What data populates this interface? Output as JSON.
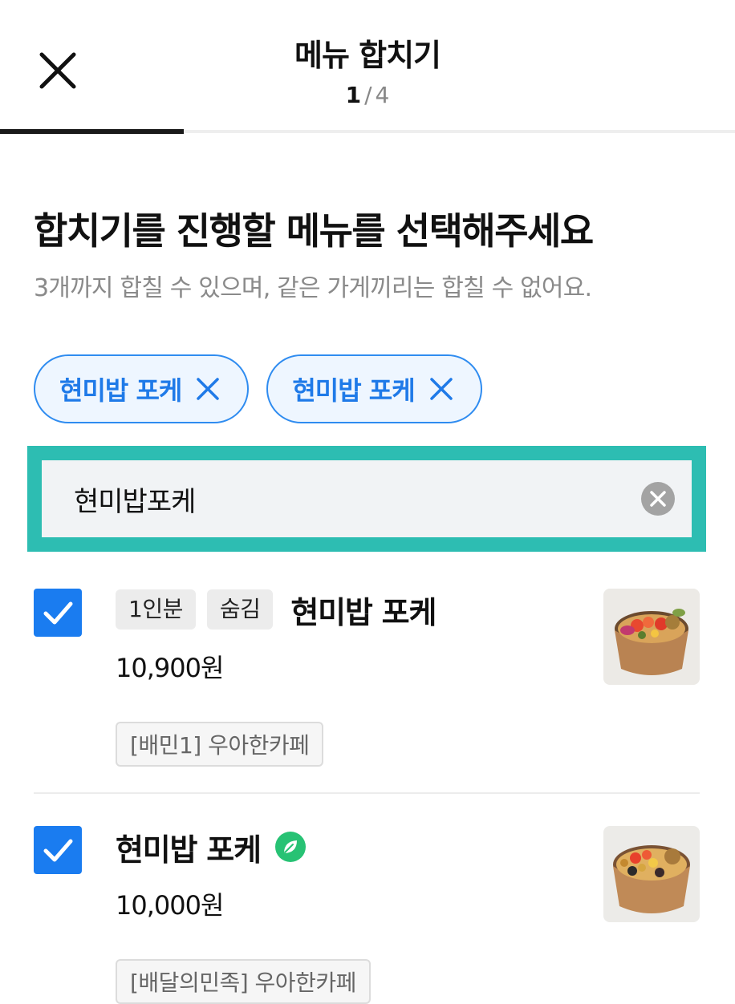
{
  "header": {
    "title": "메뉴 합치기",
    "step_current": "1",
    "step_separator": "/",
    "step_total": "4",
    "progress": 0.25
  },
  "heading": "합치기를 진행할 메뉴를 선택해주세요",
  "subheading": "3개까지 합칠 수 있으며, 같은 가게끼리는 합칠 수 없어요.",
  "selected_chips": [
    {
      "label": "현미밥 포케"
    },
    {
      "label": "현미밥 포케"
    }
  ],
  "search": {
    "value": "현미밥포케"
  },
  "results": [
    {
      "checked": true,
      "tags": [
        "1인분",
        "숨김"
      ],
      "name": "현미밥 포케",
      "price": "10,900원",
      "store": "[배민1] 우아한카페",
      "eco_badge": false
    },
    {
      "checked": true,
      "tags": [],
      "name": "현미밥 포케",
      "price": "10,000원",
      "store": "[배달의민족] 우아한카페",
      "eco_badge": true
    }
  ],
  "colors": {
    "accent": "#1a7cf0",
    "chip_bg": "#eef6ff",
    "focus_border": "#2dbdb2",
    "eco_green": "#27c274"
  }
}
